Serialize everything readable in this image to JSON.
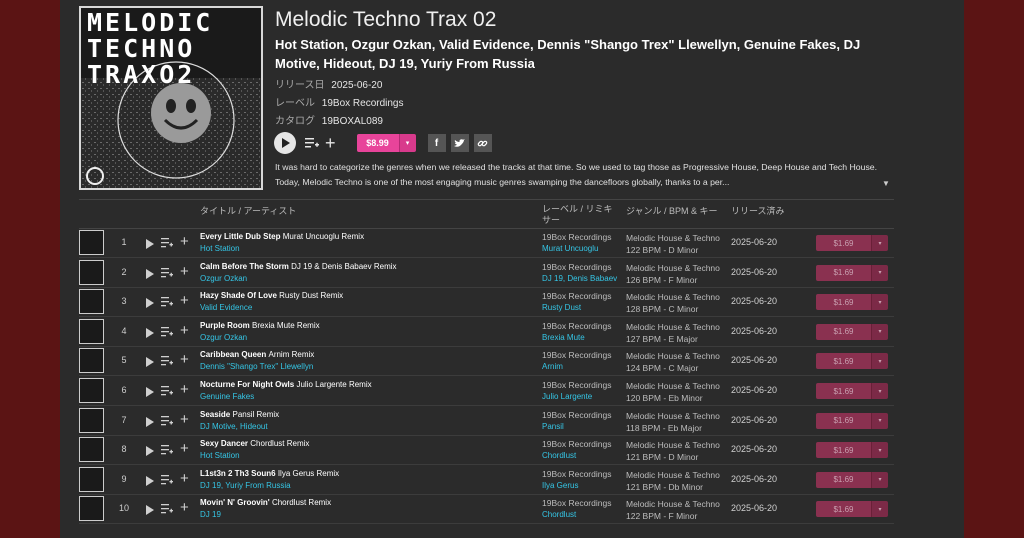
{
  "release": {
    "cover_text": [
      "MELODIC",
      "TECHNO",
      "TRAXO2"
    ],
    "title": "Melodic Techno Trax 02",
    "artists": "Hot Station, Ozgur Ozkan, Valid Evidence, Dennis \"Shango Trex\" Llewellyn, Genuine Fakes, DJ Motive, Hideout, DJ 19, Yuriy From Russia",
    "release_date_label": "リリース日",
    "release_date": "2025-06-20",
    "label_label": "レーベル",
    "label": "19Box Recordings",
    "catalog_label": "カタログ",
    "catalog": "19BOXAL089",
    "price": "$8.99",
    "description": "It was hard to categorize the genres when we released the tracks at that time. So we used to tag those as Progressive House, Deep House and Tech House. Today, Melodic Techno is one of the most engaging music genres swamping the dancefloors globally, thanks to a per..."
  },
  "icons": {
    "play": "play-icon",
    "queue": "add-to-queue-icon",
    "add": "plus-icon",
    "facebook": "f",
    "twitter": "twitter-icon",
    "link": "link-icon",
    "dropdown": "▾",
    "expand": "▼"
  },
  "table": {
    "headers": {
      "title": "タイトル / アーティスト",
      "label": "レーベル / リミキサー",
      "genre": "ジャンル / BPM & キー",
      "released": "リリース済み"
    },
    "rows": [
      {
        "n": "1",
        "track": "Every Little Dub Step",
        "mix": "Murat Uncuoglu Remix",
        "artist": "Hot Station",
        "label": "19Box Recordings",
        "remixer": "Murat Uncuoglu",
        "genre": "Melodic House & Techno",
        "bpmkey": "122 BPM - D Minor",
        "date": "2025-06-20",
        "price": "$1.69"
      },
      {
        "n": "2",
        "track": "Calm Before The Storm",
        "mix": "DJ 19 & Denis Babaev Remix",
        "artist": "Ozgur Ozkan",
        "label": "19Box Recordings",
        "remixer": "DJ 19, Denis Babaev",
        "genre": "Melodic House & Techno",
        "bpmkey": "126 BPM - F Minor",
        "date": "2025-06-20",
        "price": "$1.69"
      },
      {
        "n": "3",
        "track": "Hazy Shade Of Love",
        "mix": "Rusty Dust Remix",
        "artist": "Valid Evidence",
        "label": "19Box Recordings",
        "remixer": "Rusty Dust",
        "genre": "Melodic House & Techno",
        "bpmkey": "128 BPM - C Minor",
        "date": "2025-06-20",
        "price": "$1.69"
      },
      {
        "n": "4",
        "track": "Purple Room",
        "mix": "Brexia Mute Remix",
        "artist": "Ozgur Ozkan",
        "label": "19Box Recordings",
        "remixer": "Brexia Mute",
        "genre": "Melodic House & Techno",
        "bpmkey": "127 BPM - E Major",
        "date": "2025-06-20",
        "price": "$1.69"
      },
      {
        "n": "5",
        "track": "Caribbean Queen",
        "mix": "Arnim Remix",
        "artist": "Dennis \"Shango Trex\" Llewellyn",
        "label": "19Box Recordings",
        "remixer": "Arnim",
        "genre": "Melodic House & Techno",
        "bpmkey": "124 BPM - C Major",
        "date": "2025-06-20",
        "price": "$1.69"
      },
      {
        "n": "6",
        "track": "Nocturne For Night Owls",
        "mix": "Julio Largente Remix",
        "artist": "Genuine Fakes",
        "label": "19Box Recordings",
        "remixer": "Julio Largente",
        "genre": "Melodic House & Techno",
        "bpmkey": "120 BPM - Eb Minor",
        "date": "2025-06-20",
        "price": "$1.69"
      },
      {
        "n": "7",
        "track": "Seaside",
        "mix": "Pansil Remix",
        "artist": "DJ Motive, Hideout",
        "label": "19Box Recordings",
        "remixer": "Pansil",
        "genre": "Melodic House & Techno",
        "bpmkey": "118 BPM - Eb Major",
        "date": "2025-06-20",
        "price": "$1.69"
      },
      {
        "n": "8",
        "track": "Sexy Dancer",
        "mix": "Chordlust Remix",
        "artist": "Hot Station",
        "label": "19Box Recordings",
        "remixer": "Chordlust",
        "genre": "Melodic House & Techno",
        "bpmkey": "121 BPM - D Minor",
        "date": "2025-06-20",
        "price": "$1.69"
      },
      {
        "n": "9",
        "track": "L1st3n 2 Th3 Soun6",
        "mix": "Ilya Gerus Remix",
        "artist": "DJ 19, Yuriy From Russia",
        "label": "19Box Recordings",
        "remixer": "Ilya Gerus",
        "genre": "Melodic House & Techno",
        "bpmkey": "121 BPM - Db Minor",
        "date": "2025-06-20",
        "price": "$1.69"
      },
      {
        "n": "10",
        "track": "Movin' N' Groovin'",
        "mix": "Chordlust Remix",
        "artist": "DJ 19",
        "label": "19Box Recordings",
        "remixer": "Chordlust",
        "genre": "Melodic House & Techno",
        "bpmkey": "122 BPM - F Minor",
        "date": "2025-06-20",
        "price": "$1.69"
      }
    ]
  }
}
